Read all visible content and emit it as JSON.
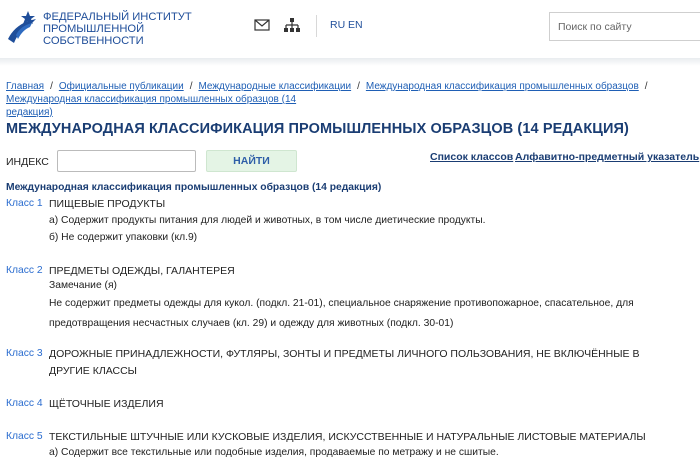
{
  "header": {
    "org_line1": "ФЕДЕРАЛЬНЫЙ ИНСТИТУТ",
    "org_line2": "ПРОМЫШЛЕННОЙ",
    "org_line3": "СОБСТВЕННОСТИ",
    "logo_icon": "fips-logo",
    "mail_icon": "envelope-icon",
    "sitemap_icon": "sitemap-icon",
    "lang_ru": "RU",
    "lang_en": "EN",
    "search_placeholder": "Поиск по сайту"
  },
  "breadcrumb": {
    "items": [
      "Главная",
      "Официальные публикации",
      "Международные классификации",
      "Международная классификация промышленных образцов",
      "редакция)"
    ],
    "last_prefix": "Международная классификация промышленных образцов (14",
    "separator": "/"
  },
  "page_title": "МЕЖДУНАРОДНАЯ КЛАССИФИКАЦИЯ ПРОМЫШЛЕННЫХ ОБРАЗЦОВ (14 РЕДАКЦИЯ)",
  "search_form": {
    "index_label": "ИНДЕКС",
    "index_value": "",
    "find_button": "НАЙТИ",
    "link_classes": "Список классов",
    "link_index": "Алфавитно-предметный указатель"
  },
  "subtitle": "Международная классификация промышленных образцов (14 редакция)",
  "classes": [
    {
      "num": "Класс 1",
      "title": "ПИЩЕВЫЕ ПРОДУКТЫ",
      "notes": [
        "а) Содержит продукты питания для людей и животных, в том числе диетические продукты.",
        "б) Не содержит упаковки (кл.9)"
      ]
    },
    {
      "num": "Класс 2",
      "title": "ПРЕДМЕТЫ ОДЕЖДЫ, ГАЛАНТЕРЕЯ",
      "notes": [
        "Замечание (я)",
        "Не содержит предметы одежды для кукол. (подкл. 21-01), специальное снаряжение противопожарное, спасательное, для предотвращения несчастных случаев (кл. 29) и одежду для животных (подкл. 30-01)"
      ]
    },
    {
      "num": "Класс 3",
      "title": "ДОРОЖНЫЕ ПРИНАДЛЕЖНОСТИ, ФУТЛЯРЫ, ЗОНТЫ И ПРЕДМЕТЫ ЛИЧНОГО ПОЛЬЗОВАНИЯ, НЕ ВКЛЮЧЁННЫЕ В ДРУГИЕ КЛАССЫ",
      "notes": []
    },
    {
      "num": "Класс 4",
      "title": "ЩЁТОЧНЫЕ ИЗДЕЛИЯ",
      "notes": []
    },
    {
      "num": "Класс 5",
      "title": "ТЕКСТИЛЬНЫЕ ШТУЧНЫЕ ИЛИ КУСКОВЫЕ ИЗДЕЛИЯ, ИСКУССТВЕННЫЕ И НАТУРАЛЬНЫЕ ЛИСТОВЫЕ МАТЕРИАЛЫ",
      "notes": [
        "а) Содержит все текстильные или подобные изделия, продаваемые по метражу и не сшитые."
      ]
    }
  ],
  "colors": {
    "brand": "#1f4e9a",
    "title": "#1a3d73",
    "link": "#2a6ccf",
    "button_bg": "#e4f4e5"
  }
}
